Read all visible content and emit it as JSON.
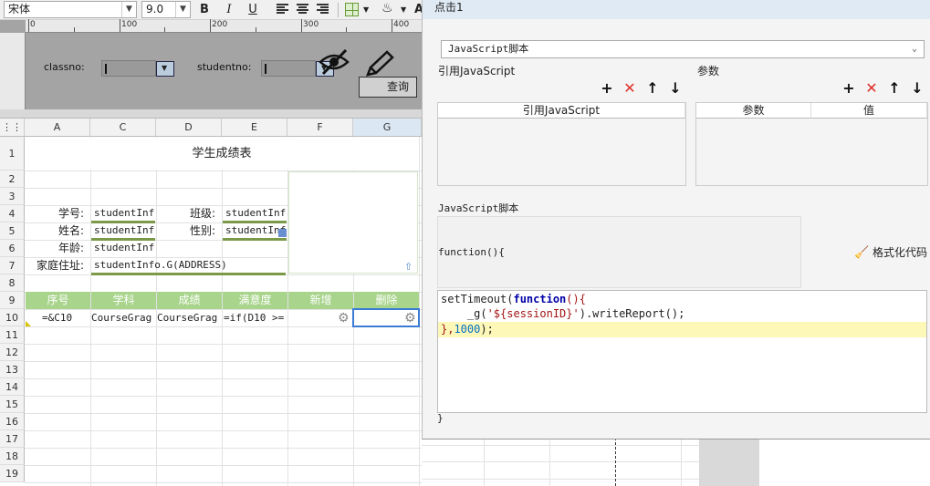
{
  "toolbar": {
    "font_name": "宋体",
    "font_size": "9.0",
    "bold": "B",
    "italic": "I",
    "underline": "U"
  },
  "design": {
    "ruler_labels": [
      "0",
      "100",
      "200",
      "300",
      "400"
    ],
    "param_classno_label": "classno:",
    "param_studentno_label": "studentno:",
    "query_label": "查询"
  },
  "grid": {
    "columns": [
      "A",
      "C",
      "D",
      "E",
      "F",
      "G"
    ],
    "rows": [
      "1",
      "2",
      "3",
      "4",
      "5",
      "6",
      "7",
      "8",
      "9",
      "10",
      "11",
      "12",
      "13",
      "14",
      "15",
      "16",
      "17",
      "18",
      "19"
    ],
    "report_title": "学生成绩表",
    "label_student_no": "学号:",
    "label_class": "班级:",
    "label_name": "姓名:",
    "label_gender": "性别:",
    "label_age": "年龄:",
    "label_address": "家庭住址:",
    "field_c4": "studentInf",
    "field_e4": "studentInf",
    "field_c5": "studentInf",
    "field_e5": "studentInf",
    "field_c6": "studentInf",
    "field_c7": "studentInfo.G(ADDRESS)",
    "headers": [
      "序号",
      "学科",
      "成绩",
      "满意度",
      "新增",
      "删除"
    ],
    "row10_a": "=&C10",
    "row10_c": "CourseGrag",
    "row10_d": "CourseGrag",
    "row10_e": "=if(D10",
    "row10_e2": ">="
  },
  "dialog": {
    "title": "点击1",
    "script_type": "JavaScript脚本",
    "ref_js_section": "引用JavaScript",
    "params_section": "参数",
    "ref_js_column": "引用JavaScript",
    "param_column": "参数",
    "value_column": "值",
    "js_script_section": "JavaScript脚本",
    "function_header": "function(){",
    "format_code": "格式化代码",
    "closing_brace": "}",
    "code": {
      "l1_a": "setTimeout(",
      "l1_kw": "function",
      "l1_b": "(){",
      "l2_a": "    _g(",
      "l2_str": "'${sessionID}'",
      "l2_b": ").writeReport();",
      "l3_a": "},",
      "l3_num": "1000",
      "l3_b": ");"
    }
  }
}
